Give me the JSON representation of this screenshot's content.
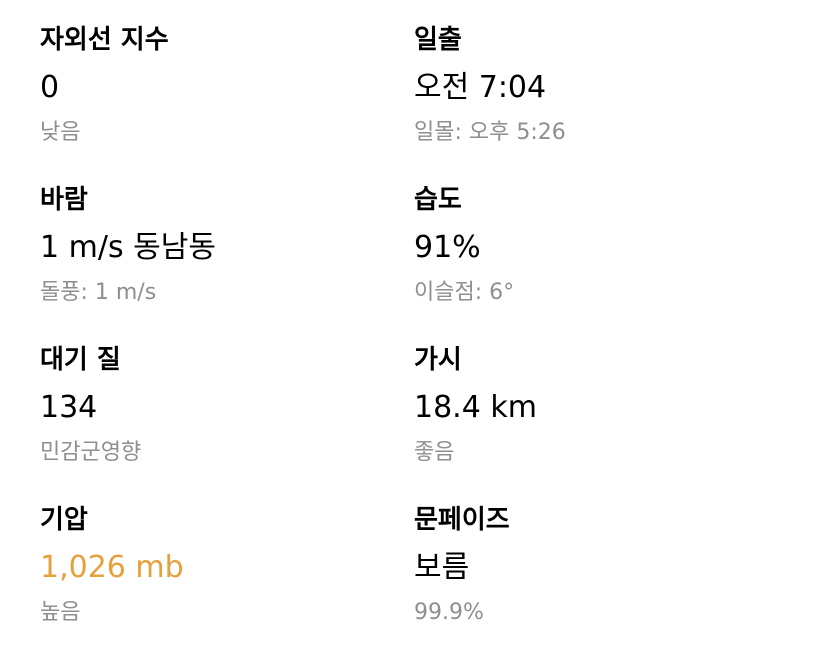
{
  "colors": {
    "text": "#000000",
    "secondary": "#8e8e93",
    "accent": "#e6a03c"
  },
  "tiles": [
    {
      "title": "자외선 지수",
      "value": "0",
      "sub": "낮음"
    },
    {
      "title": "일출",
      "value": "오전 7:04",
      "sub": "일몰: 오후 5:26"
    },
    {
      "title": "바람",
      "value": "1 m/s 동남동",
      "sub": "돌풍: 1 m/s"
    },
    {
      "title": "습도",
      "value": "91%",
      "sub": "이슬점: 6°"
    },
    {
      "title": "대기 질",
      "value": "134",
      "sub": "민감군영향"
    },
    {
      "title": "가시",
      "value": "18.4 km",
      "sub": "좋음"
    },
    {
      "title": "기압",
      "value": "1,026 mb",
      "sub": "높음"
    },
    {
      "title": "문페이즈",
      "value": "보름",
      "sub": "99.9%"
    }
  ]
}
